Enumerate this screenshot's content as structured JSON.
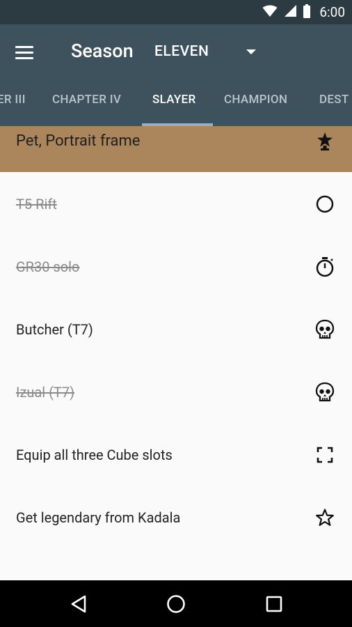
{
  "status_bar": {
    "time": "6:00",
    "icons": [
      "wifi-icon",
      "cell-signal-icon",
      "battery-icon"
    ]
  },
  "app_bar": {
    "title": "Season",
    "season_selected": "ELEVEN",
    "colors": {
      "status_bar": "#2c3b42",
      "app_bar": "#3d525c",
      "indicator": "#8fb3c4"
    }
  },
  "tabs": [
    {
      "label": "ER III",
      "active": false
    },
    {
      "label": "CHAPTER IV",
      "active": false
    },
    {
      "label": "SLAYER",
      "active": true
    },
    {
      "label": "CHAMPION",
      "active": false
    },
    {
      "label": "DEST",
      "active": false
    }
  ],
  "reward": {
    "label": "Pet, Portrait frame",
    "icon": "trophy-icon",
    "color": "#ab855b"
  },
  "tasks": [
    {
      "label": "T5 Rift",
      "done": true,
      "icon": "circle-icon"
    },
    {
      "label": "GR30 solo",
      "done": true,
      "icon": "timer-icon"
    },
    {
      "label": "Butcher (T7)",
      "done": false,
      "icon": "skull-icon"
    },
    {
      "label": "Izual (T7)",
      "done": true,
      "icon": "skull-icon"
    },
    {
      "label": "Equip all three Cube slots",
      "done": false,
      "icon": "cube-slots-icon"
    },
    {
      "label": "Get legendary from Kadala",
      "done": false,
      "icon": "star-outline-icon"
    }
  ],
  "nav_bar": {
    "buttons": [
      "back-icon",
      "home-icon",
      "recents-icon"
    ]
  }
}
